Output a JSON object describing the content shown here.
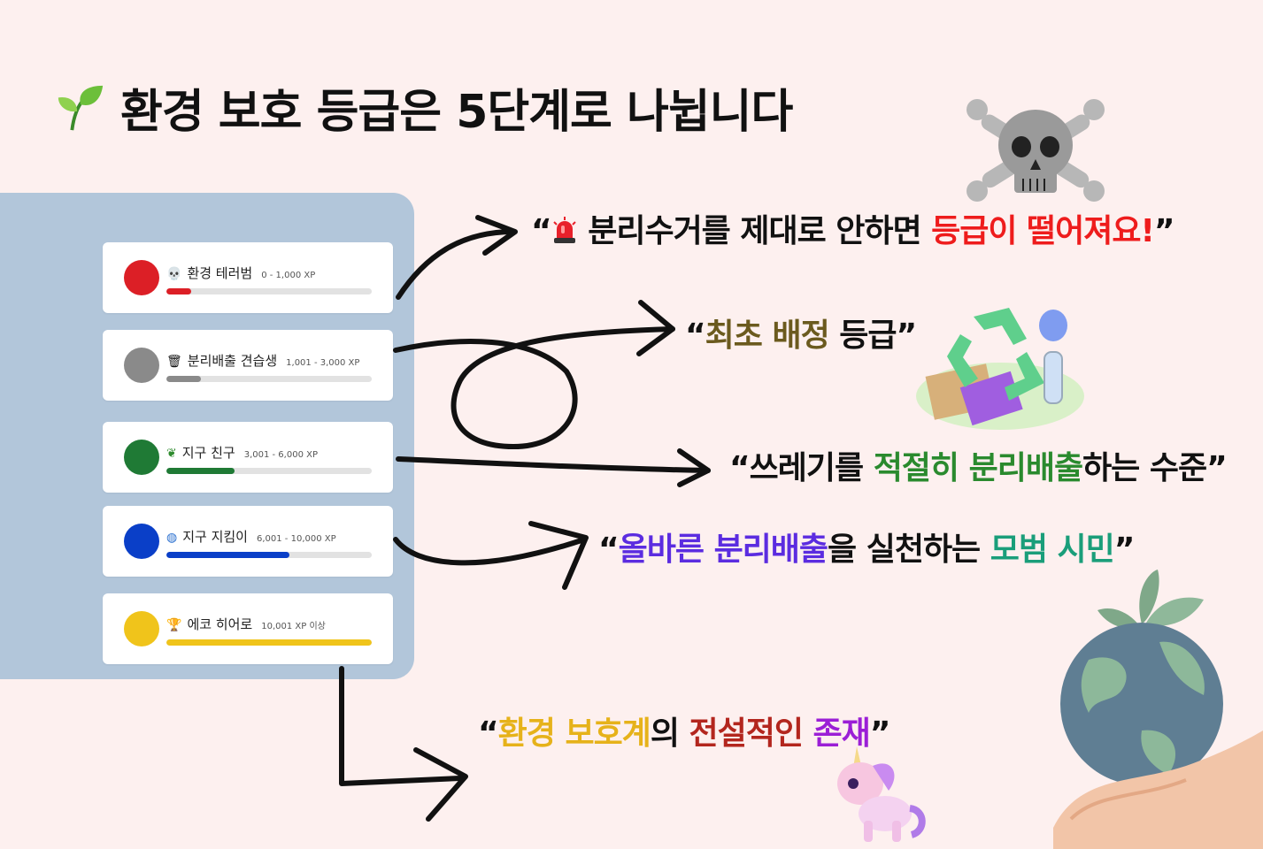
{
  "title": {
    "icon": "sprout-icon",
    "text": "환경 보호 등급은 5단계로 나뉩니다"
  },
  "levels": [
    {
      "icon": "skull-icon",
      "name": "환경 테러범",
      "xp": "0 - 1,000 XP",
      "color": "#dc1f26",
      "progress": 0.12
    },
    {
      "icon": "trash-can-icon",
      "name": "분리배출 견습생",
      "xp": "1,001 - 3,000 XP",
      "color": "#8a8a8a",
      "progress": 0.17
    },
    {
      "icon": "herb-icon",
      "name": "지구 친구",
      "xp": "3,001 - 6,000 XP",
      "color": "#1f7a35",
      "progress": 0.33
    },
    {
      "icon": "globe-icon",
      "name": "지구 지킴이",
      "xp": "6,001 - 10,000 XP",
      "color": "#0a3fc8",
      "progress": 0.6
    },
    {
      "icon": "trophy-icon",
      "name": "에코 히어로",
      "xp": "10,001 XP 이상",
      "color": "#f0c41b",
      "progress": 1.0
    }
  ],
  "quotes": {
    "q1": {
      "open": "“",
      "icon": "siren-icon",
      "a": " 분리수거를 제대로 안하면 ",
      "b": "등급이 떨어져요!",
      "close": "”",
      "color_b": "#ee1c1c"
    },
    "q2": {
      "open": "“",
      "a": "최초 배정",
      "b": " 등급",
      "close": "”",
      "color_a": "#6b5a1e"
    },
    "q3": {
      "open": "“",
      "a": "쓰레기를 ",
      "b": "적절히 분리배출",
      "c": "하는 수준",
      "close": "”",
      "color_b": "#2a8a2e"
    },
    "q4": {
      "open": "“",
      "a": "올바른 분리배출",
      "b": "을 실천하는 ",
      "c": "모범 시민",
      "close": "”",
      "color_a": "#5b2ce0",
      "color_c": "#1a9e7a"
    },
    "q5": {
      "open": "“",
      "a": "환경 보호계",
      "b": "의 ",
      "c": "전설적인",
      "d": " ",
      "e": "존재",
      "close": "”",
      "color_a": "#e6b21a",
      "color_c": "#b3261e",
      "color_e": "#9b1fd6"
    }
  },
  "decorations": [
    "skull-crossbones-icon",
    "recycling-icon",
    "unicorn-icon",
    "earth-in-hand-icon"
  ]
}
